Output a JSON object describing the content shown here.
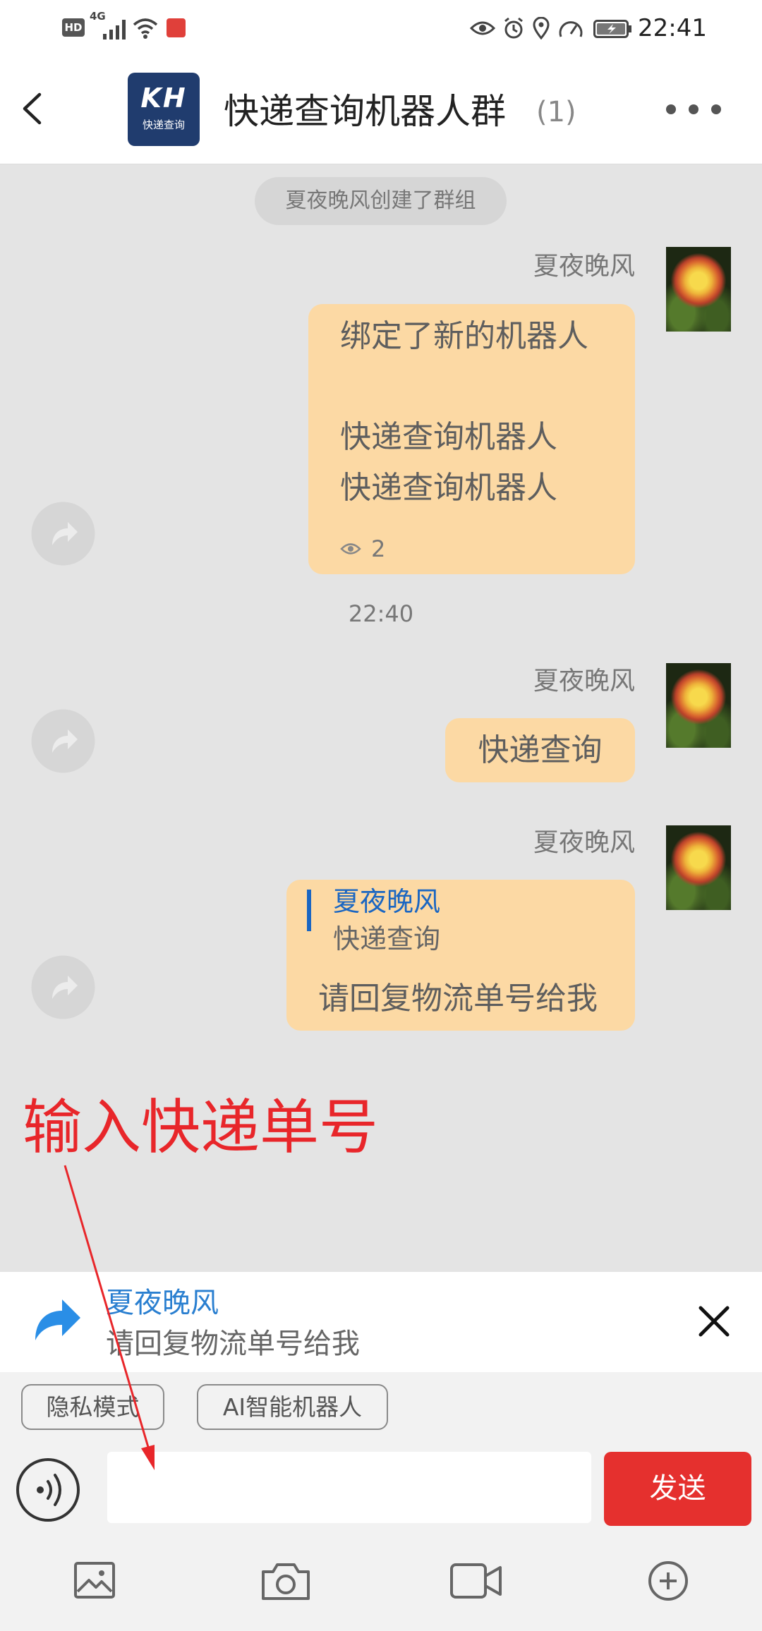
{
  "status_bar": {
    "network_badge": "HD",
    "network_type": "4G",
    "time": "22:41",
    "icons": [
      "signal-icon",
      "wifi-icon",
      "app-notification-icon",
      "eye-icon",
      "alarm-icon",
      "location-icon",
      "gauge-icon",
      "battery-icon"
    ]
  },
  "header": {
    "logo_text": "KH",
    "logo_subtitle": "快递查询",
    "title": "快递查询机器人群",
    "member_count": "(1)",
    "icons": [
      "chevron-left-icon",
      "more-dots-icon"
    ]
  },
  "chat": {
    "system_notice": "夏夜晚风创建了群组",
    "timestamp": "22:40",
    "messages": [
      {
        "sender": "夏夜晚风",
        "lines": [
          "绑定了新的机器人",
          "快递查询机器人",
          "快递查询机器人"
        ],
        "read_count": "2"
      },
      {
        "sender": "夏夜晚风",
        "text": "快递查询"
      },
      {
        "sender": "夏夜晚风",
        "quote": {
          "sender": "夏夜晚风",
          "text": "快递查询"
        },
        "text": "请回复物流单号给我"
      }
    ]
  },
  "annotation": {
    "text": "输入快递单号"
  },
  "reply_preview": {
    "sender": "夏夜晚风",
    "text": "请回复物流单号给我"
  },
  "composer": {
    "chips": [
      "隐私模式",
      "AI智能机器人"
    ],
    "input_value": "",
    "send_label": "发送"
  },
  "toolbar": {
    "icons": [
      "image-icon",
      "camera-icon",
      "video-icon",
      "plus-circle-icon"
    ]
  },
  "colors": {
    "bubble": "#fcd9a4",
    "chat_background": "#e4e4e4",
    "accent_blue": "#2a7fd0",
    "send_button": "#e5302e",
    "annotation": "#e8262a",
    "logo_background": "#203c6e"
  }
}
